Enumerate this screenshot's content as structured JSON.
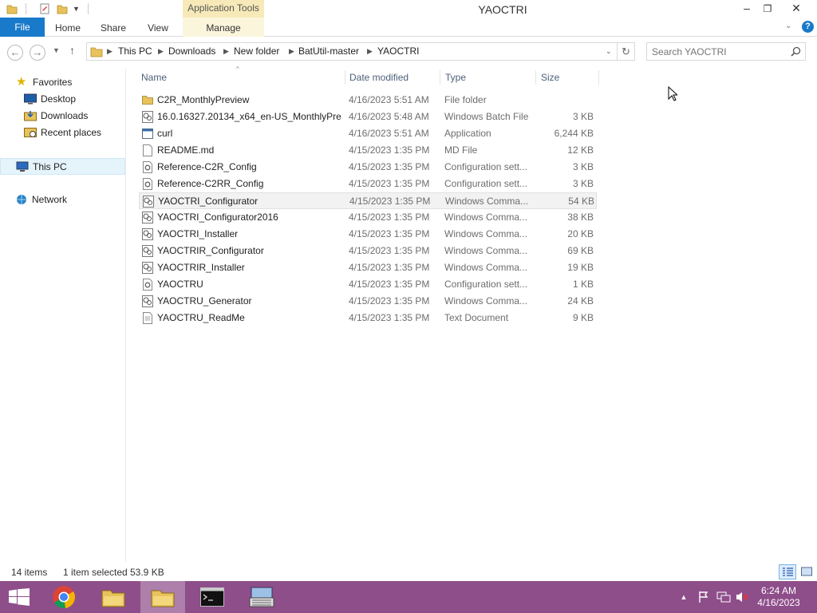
{
  "window": {
    "title": "YAOCTRI",
    "context_tab": "Application Tools"
  },
  "ribbon": {
    "tabs": [
      "File",
      "Home",
      "Share",
      "View",
      "Manage"
    ]
  },
  "address_bar": {
    "crumbs": [
      "This PC",
      "Downloads",
      "New folder",
      "BatUtil-master",
      "YAOCTRI"
    ]
  },
  "search": {
    "placeholder": "Search YAOCTRI"
  },
  "nav_pane": {
    "favorites": "Favorites",
    "desktop": "Desktop",
    "downloads": "Downloads",
    "recent": "Recent places",
    "this_pc": "This PC",
    "network": "Network"
  },
  "columns": {
    "name": "Name",
    "date": "Date modified",
    "type": "Type",
    "size": "Size"
  },
  "files": [
    {
      "name": "C2R_MonthlyPreview",
      "date": "4/16/2023 5:51 AM",
      "type": "File folder",
      "size": "",
      "icon": "folder-icon"
    },
    {
      "name": "16.0.16327.20134_x64_en-US_MonthlyPre...",
      "date": "4/16/2023 5:48 AM",
      "type": "Windows Batch File",
      "size": "3 KB",
      "icon": "batch-file-icon"
    },
    {
      "name": "curl",
      "date": "4/16/2023 5:51 AM",
      "type": "Application",
      "size": "6,244 KB",
      "icon": "application-icon"
    },
    {
      "name": "README.md",
      "date": "4/15/2023 1:35 PM",
      "type": "MD File",
      "size": "12 KB",
      "icon": "document-icon"
    },
    {
      "name": "Reference-C2R_Config",
      "date": "4/15/2023 1:35 PM",
      "type": "Configuration sett...",
      "size": "3 KB",
      "icon": "config-file-icon"
    },
    {
      "name": "Reference-C2RR_Config",
      "date": "4/15/2023 1:35 PM",
      "type": "Configuration sett...",
      "size": "3 KB",
      "icon": "config-file-icon"
    },
    {
      "name": "YAOCTRI_Configurator",
      "date": "4/15/2023 1:35 PM",
      "type": "Windows Comma...",
      "size": "54 KB",
      "icon": "cmd-script-icon",
      "selected": true
    },
    {
      "name": "YAOCTRI_Configurator2016",
      "date": "4/15/2023 1:35 PM",
      "type": "Windows Comma...",
      "size": "38 KB",
      "icon": "cmd-script-icon"
    },
    {
      "name": "YAOCTRI_Installer",
      "date": "4/15/2023 1:35 PM",
      "type": "Windows Comma...",
      "size": "20 KB",
      "icon": "cmd-script-icon"
    },
    {
      "name": "YAOCTRIR_Configurator",
      "date": "4/15/2023 1:35 PM",
      "type": "Windows Comma...",
      "size": "69 KB",
      "icon": "cmd-script-icon"
    },
    {
      "name": "YAOCTRIR_Installer",
      "date": "4/15/2023 1:35 PM",
      "type": "Windows Comma...",
      "size": "19 KB",
      "icon": "cmd-script-icon"
    },
    {
      "name": "YAOCTRU",
      "date": "4/15/2023 1:35 PM",
      "type": "Configuration sett...",
      "size": "1 KB",
      "icon": "config-file-icon"
    },
    {
      "name": "YAOCTRU_Generator",
      "date": "4/15/2023 1:35 PM",
      "type": "Windows Comma...",
      "size": "24 KB",
      "icon": "cmd-script-icon"
    },
    {
      "name": "YAOCTRU_ReadMe",
      "date": "4/15/2023 1:35 PM",
      "type": "Text Document",
      "size": "9 KB",
      "icon": "text-file-icon"
    }
  ],
  "status": {
    "items": "14 items",
    "selected": "1 item selected",
    "size": "53.9 KB"
  },
  "taskbar": {
    "time": "6:24 AM",
    "date": "4/16/2023"
  },
  "colors": {
    "accent": "#1979ca",
    "taskbar": "#8e4e8a",
    "context_tab": "#f7eab8"
  }
}
